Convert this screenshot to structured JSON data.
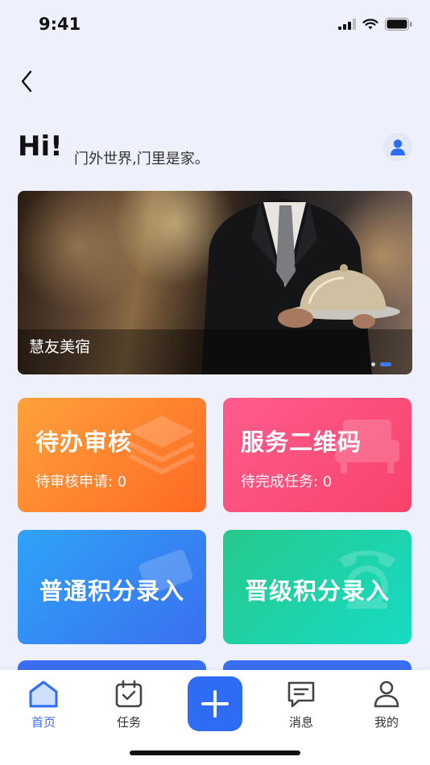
{
  "status_bar": {
    "time": "9:41"
  },
  "header": {
    "greeting": "Hi!",
    "subtitle": "门外世界,门里是家。"
  },
  "banner": {
    "caption": "慧友美宿",
    "slides_count": 2,
    "active_slide": 2
  },
  "cards": {
    "pending_review": {
      "title": "待办审核",
      "subtitle": "待审核申请: 0"
    },
    "service_qrcode": {
      "title": "服务二维码",
      "subtitle": "待完成任务: 0"
    },
    "points_entry": {
      "title": "普通积分录入"
    },
    "upgrade_points_entry": {
      "title": "晋级积分录入"
    }
  },
  "tab_bar": {
    "items": [
      {
        "label": "首页",
        "icon": "home-icon",
        "active": true
      },
      {
        "label": "任务",
        "icon": "calendar-check-icon",
        "active": false
      },
      {
        "label": "",
        "icon": "plus-icon",
        "active": false
      },
      {
        "label": "消息",
        "icon": "message-icon",
        "active": false
      },
      {
        "label": "我的",
        "icon": "user-icon",
        "active": false
      }
    ]
  },
  "colors": {
    "accent": "#3b6ff3",
    "card_orange": "#ff7a2a",
    "card_pink": "#f94a74",
    "card_blue": "#3380f3",
    "card_green": "#1fd2ad",
    "background": "#eef1fb"
  }
}
